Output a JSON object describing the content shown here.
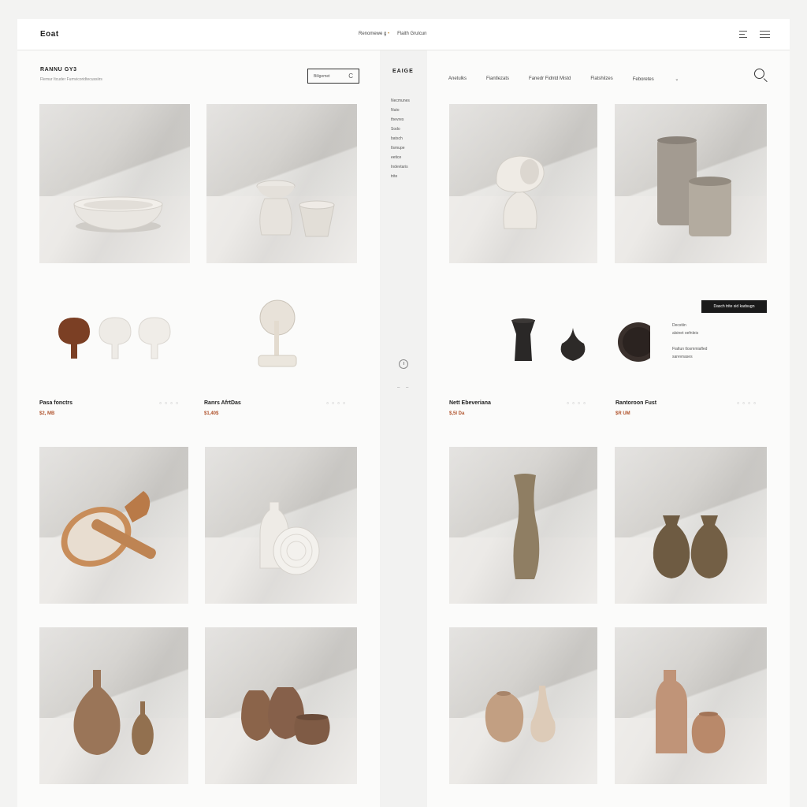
{
  "header": {
    "brand": "Eoat",
    "nav_main": "Renomewe g",
    "nav_second": "Flaith Grulcun",
    "icons": [
      "filter-icon",
      "menu-icon"
    ]
  },
  "left_panel": {
    "title": "RANNU GY3",
    "subtitle": "Flemur Itcuder Fumvicoridtecussiirs",
    "search_label": "Biligemet",
    "search_icon_glyph": "C"
  },
  "middle_strip": {
    "title": "EAIGE",
    "items": [
      "Necmunes",
      "Nuto",
      "thevres",
      "Sodo",
      "batsch",
      "Ilsmupe",
      "eetice",
      "Indevtaris",
      "trite"
    ]
  },
  "right_panel": {
    "nav": [
      "Anetulks",
      "Fiantlezats",
      "Fanedr Fidntd Mistd",
      "Flatshilzes",
      "Feboretes"
    ],
    "cta_label": "Dasch trite sid kadsugn",
    "desc_a": [
      "Decstiin",
      "alsinet oefnleis"
    ],
    "desc_b": [
      "Fialtun tlosmmiafled",
      "sarevnases"
    ]
  },
  "products": [
    {
      "name": "Pasa fonctrs",
      "price": "$2, MB"
    },
    {
      "name": "Ranrs AfrtDas",
      "price": "$1,40$"
    },
    {
      "name": "Nett Ebeveriana",
      "price": "$,5I Da"
    },
    {
      "name": "Rantoroon Fust",
      "price": "$R UM"
    }
  ],
  "colors": {
    "accent": "#b0532c",
    "dark": "#1a1a1a",
    "background": "#fbfbfa"
  }
}
